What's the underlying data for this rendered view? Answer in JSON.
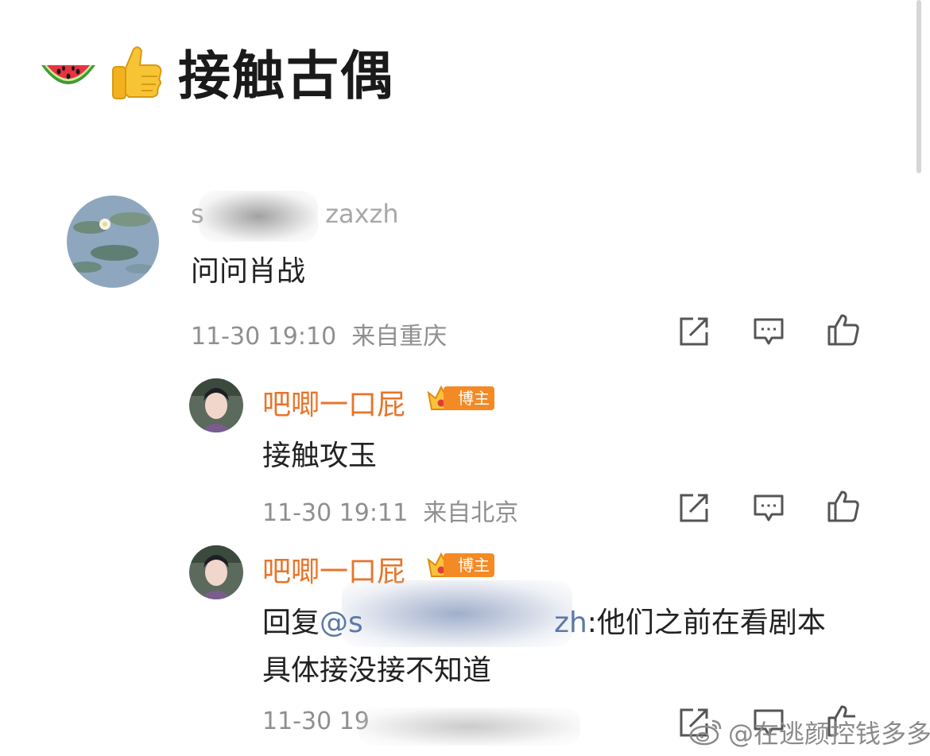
{
  "post": {
    "title": "接触古偶",
    "emojis": [
      "watermelon-icon",
      "thumbs-up-icon"
    ]
  },
  "comments": [
    {
      "username": "s               zaxzh",
      "text": "问问肖战",
      "time": "11-30 19:10",
      "location": "来自重庆"
    },
    {
      "username": "吧唧一口屁",
      "badge": "博主",
      "text": "接触攻玉",
      "time": "11-30 19:11",
      "location": "来自北京"
    },
    {
      "username": "吧唧一口屁",
      "badge": "博主",
      "text_prefix": "回复",
      "mention": "@s                     zh",
      "text_rest": ":他们之前在看剧本",
      "text_line2": "具体接没接不知道",
      "time": "11-30 19",
      "location": ""
    }
  ],
  "watermark": "@在逃颜控钱多多",
  "colors": {
    "accent_username": "#e8742a",
    "meta_gray": "#8f8f8f",
    "badge_orange": "#f48a24",
    "mention_blue": "#5b79a8"
  }
}
